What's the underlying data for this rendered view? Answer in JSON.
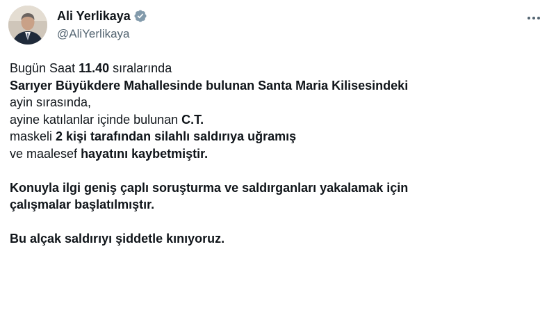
{
  "author": {
    "display_name": "Ali Yerlikaya",
    "handle": "@AliYerlikaya",
    "verified": true,
    "avatar_icon": "profile-photo",
    "verified_icon": "verified-badge-icon",
    "more_icon": "more-options-icon"
  },
  "colors": {
    "text": "#0f1419",
    "secondary": "#536471",
    "verified": "#829aab"
  },
  "tweet": {
    "l1_a": "Bugün Saat ",
    "l1_b": "11.40",
    "l1_c": " sıralarında",
    "l2": "Sarıyer Büyükdere Mahallesinde bulunan Santa Maria Kilisesindeki",
    "l3": "ayin sırasında,",
    "l4_a": "ayine katılanlar içinde bulunan ",
    "l4_b": "C.T.",
    "l5_a": "maskeli ",
    "l5_b": "2 kişi tarafından silahlı saldırıya uğramış",
    "l6_a": "ve maalesef ",
    "l6_b": "hayatını kaybetmiştir.",
    "p2_l1": "Konuyla ilgi geniş çaplı soruşturma ve saldırganları yakalamak için",
    "p2_l2": "çalışmalar başlatılmıştır.",
    "p3_l1": "Bu alçak saldırıyı şiddetle kınıyoruz."
  }
}
